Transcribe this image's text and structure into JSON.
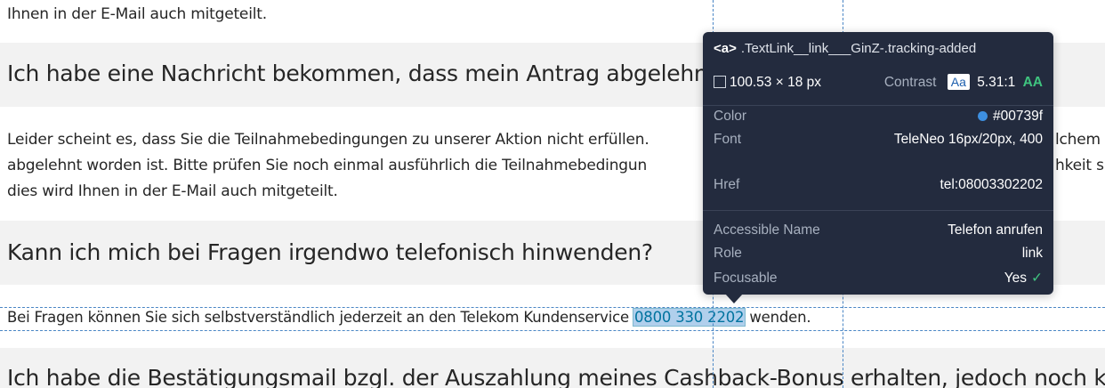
{
  "content": {
    "line_top": "Ihnen in der E-Mail auch mitgeteilt.",
    "q1": "Ich habe eine Nachricht bekommen, dass mein Antrag abgelehnt wurde.",
    "a1_line1_left": "Leider scheint es, dass Sie die Teilnahmebedingungen zu unserer Aktion nicht erfüllen.",
    "a1_line1_right": "lchem",
    "a1_line2_left": "abgelehnt worden ist. Bitte prüfen Sie noch einmal ausführlich die Teilnahmebedingun",
    "a1_line2_right": "hkeit s",
    "a1_line3": "dies wird Ihnen in der E-Mail auch mitgeteilt.",
    "q2": "Kann ich mich bei Fragen irgendwo telefonisch hinwenden?",
    "a2_before": "Bei Fragen können Sie sich selbstverständlich jederzeit an den Telekom Kundenservice",
    "a2_link": "0800 330 2202",
    "a2_after": "wenden.",
    "q3": "Ich habe die Bestätigungsmail bzgl. der Auszahlung meines Cashback-Bonus erhalten, jedoch noch keinen G"
  },
  "inspector": {
    "tag": "<a>",
    "selector": ".TextLink__link___GinZ-.tracking-added",
    "dimensions": "100.53 × 18 px",
    "contrast_label": "Contrast",
    "contrast_badge": "Aa",
    "contrast_value": "5.31:1",
    "contrast_rating": "AA",
    "color_label": "Color",
    "color_value": "#00739f",
    "font_label": "Font",
    "font_value": "TeleNeo 16px/20px, 400",
    "href_label": "Href",
    "href_value": "tel:08003302202",
    "accname_label": "Accessible Name",
    "accname_value": "Telefon anrufen",
    "role_label": "Role",
    "role_value": "link",
    "focusable_label": "Focusable",
    "focusable_value": "Yes"
  },
  "colors": {
    "link": "#00739f",
    "tooltip_bg": "#232b3e",
    "band_bg": "#f2f2f2",
    "rating_green": "#3fc37f"
  }
}
